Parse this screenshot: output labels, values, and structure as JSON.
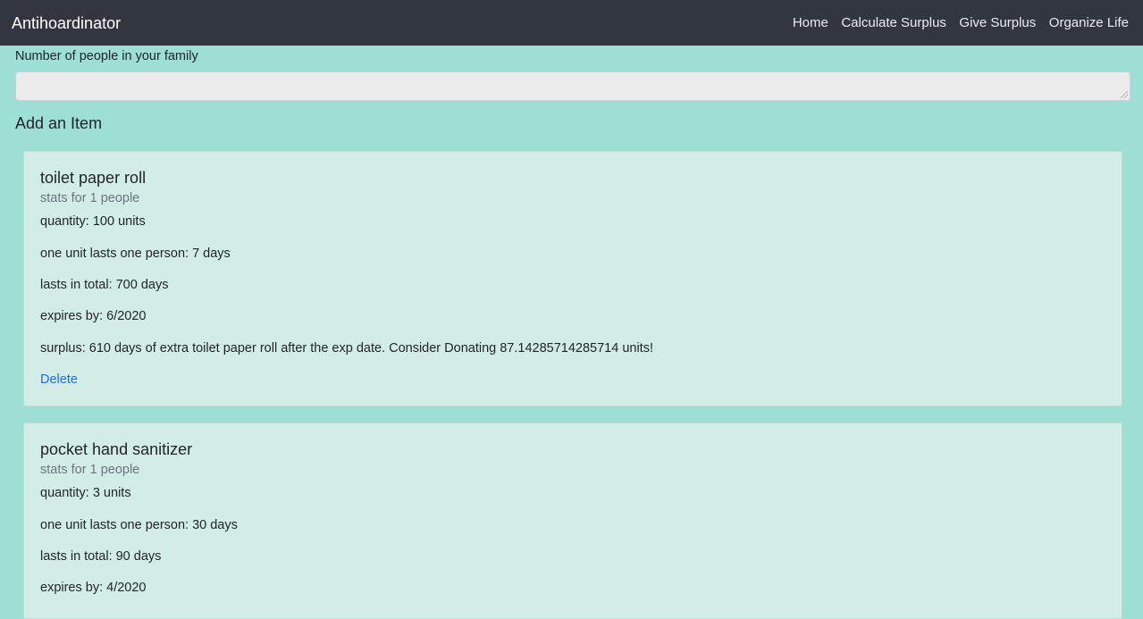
{
  "navbar": {
    "brand": "Antihoardinator",
    "links": [
      "Home",
      "Calculate Surplus",
      "Give Surplus",
      "Organize Life"
    ]
  },
  "family": {
    "label": "Number of people in your family",
    "value": ""
  },
  "add_item_heading": "Add an Item",
  "items": [
    {
      "name": "toilet paper roll",
      "subtitle": "stats for 1 people",
      "quantity": "quantity: 100 units",
      "unit_duration": "one unit lasts one person: 7 days",
      "total": "lasts in total: 700 days",
      "expires": "expires by: 6/2020",
      "surplus": "surplus: 610 days of extra toilet paper roll after the exp date. Consider Donating 87.14285714285714 units!",
      "delete_label": "Delete"
    },
    {
      "name": "pocket hand sanitizer",
      "subtitle": "stats for 1 people",
      "quantity": "quantity: 3 units",
      "unit_duration": "one unit lasts one person: 30 days",
      "total": "lasts in total: 90 days",
      "expires": "expires by: 4/2020"
    }
  ]
}
